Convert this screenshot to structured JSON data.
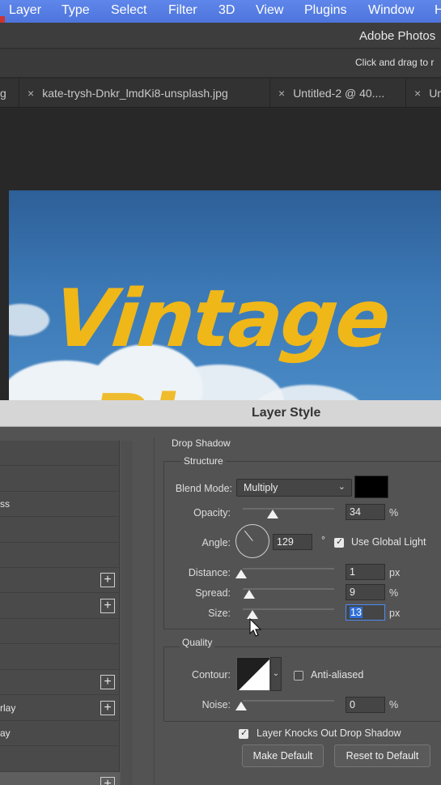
{
  "menubar": {
    "items": [
      "Layer",
      "Type",
      "Select",
      "Filter",
      "3D",
      "View",
      "Plugins",
      "Window",
      "H"
    ]
  },
  "app": {
    "title": "Adobe Photos",
    "options_hint": "Click and drag to r"
  },
  "tabs": [
    {
      "label": "g",
      "close": ""
    },
    {
      "label": "kate-trysh-Dnkr_lmdKi8-unsplash.jpg",
      "close": "×"
    },
    {
      "label": "Untitled-2 @ 40....",
      "close": "×"
    },
    {
      "label": "Un",
      "close": "×"
    }
  ],
  "canvas": {
    "text_line1": "Vintage",
    "text_line2": "Pl"
  },
  "dialog": {
    "title": "Layer Style",
    "left_list": [
      {
        "label": "",
        "plus": false
      },
      {
        "label": "",
        "plus": false
      },
      {
        "label": "ss",
        "plus": false
      },
      {
        "label": "",
        "plus": false
      },
      {
        "label": "",
        "plus": false
      },
      {
        "label": "",
        "plus": true,
        "plus_symbol": "+"
      },
      {
        "label": "",
        "plus": true,
        "plus_symbol": "+"
      },
      {
        "label": "",
        "plus": false
      },
      {
        "label": "",
        "plus": false
      },
      {
        "label": "",
        "plus": true,
        "plus_symbol": "+"
      },
      {
        "label": "rlay",
        "plus": true,
        "plus_symbol": "+"
      },
      {
        "label": "ay",
        "plus": false
      },
      {
        "label": "",
        "plus": false
      },
      {
        "label": "",
        "plus": true,
        "plus_symbol": "+"
      }
    ],
    "section_title": "Drop Shadow",
    "structure": {
      "title": "Structure",
      "blend_mode_label": "Blend Mode:",
      "blend_mode_value": "Multiply",
      "blend_color": "#000000",
      "opacity_label": "Opacity:",
      "opacity_value": "34",
      "opacity_unit": "%",
      "angle_label": "Angle:",
      "angle_value": "129",
      "angle_unit": "°",
      "use_global_light_label": "Use Global Light",
      "use_global_light_checked": true,
      "distance_label": "Distance:",
      "distance_value": "1",
      "distance_unit": "px",
      "spread_label": "Spread:",
      "spread_value": "9",
      "spread_unit": "%",
      "size_label": "Size:",
      "size_value": "13",
      "size_unit": "px"
    },
    "quality": {
      "title": "Quality",
      "contour_label": "Contour:",
      "anti_aliased_label": "Anti-aliased",
      "anti_aliased_checked": false,
      "noise_label": "Noise:",
      "noise_value": "0",
      "noise_unit": "%"
    },
    "knocks_out_label": "Layer Knocks Out Drop Shadow",
    "knocks_out_checked": true,
    "make_default_label": "Make Default",
    "reset_default_label": "Reset to Default"
  },
  "colors": {
    "menubar": "#5a80e6",
    "accent_text": "#f0b719",
    "sky": "#3b78b5",
    "dialog_bg": "#535353"
  }
}
